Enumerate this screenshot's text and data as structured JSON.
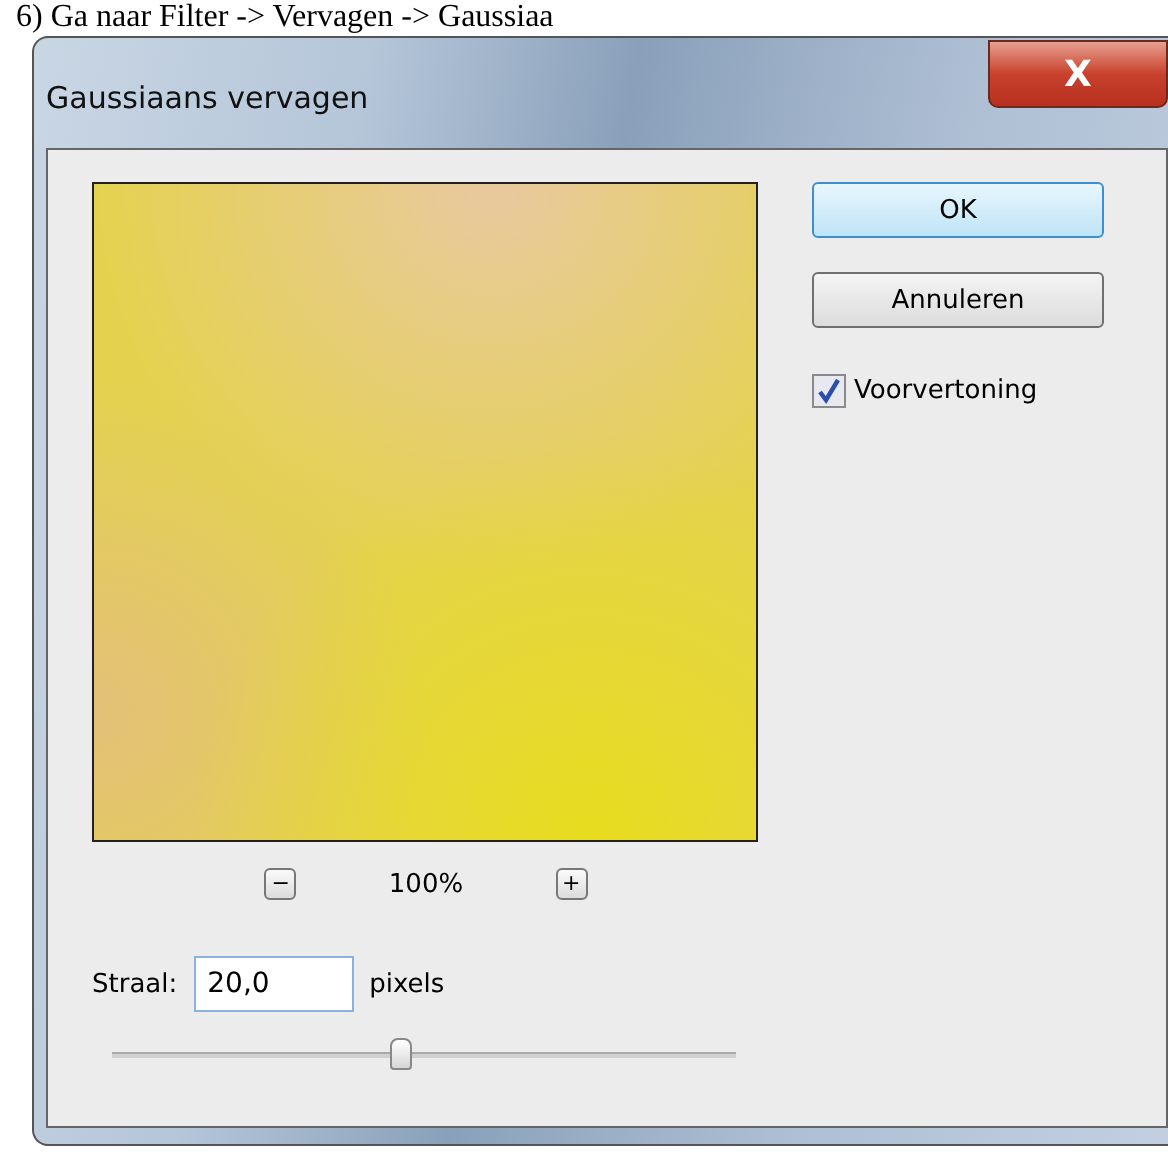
{
  "caption": "6) Ga naar Filter -> Vervagen -> Gaussiaa",
  "window": {
    "title": "Gaussiaans vervagen",
    "close": "X"
  },
  "preview": {
    "kind": "picture",
    "zoom_out": "−",
    "zoom": "100%",
    "zoom_in": "+"
  },
  "buttons": [
    {
      "label": "OK",
      "default": true
    },
    {
      "label": "Annuleren",
      "default": false
    }
  ],
  "preview_checkbox": {
    "label": "Voorvertoning",
    "checked": true
  },
  "radius": {
    "label": "Straal:",
    "value": "20,0",
    "unit": "pixels",
    "level": 0.46
  }
}
